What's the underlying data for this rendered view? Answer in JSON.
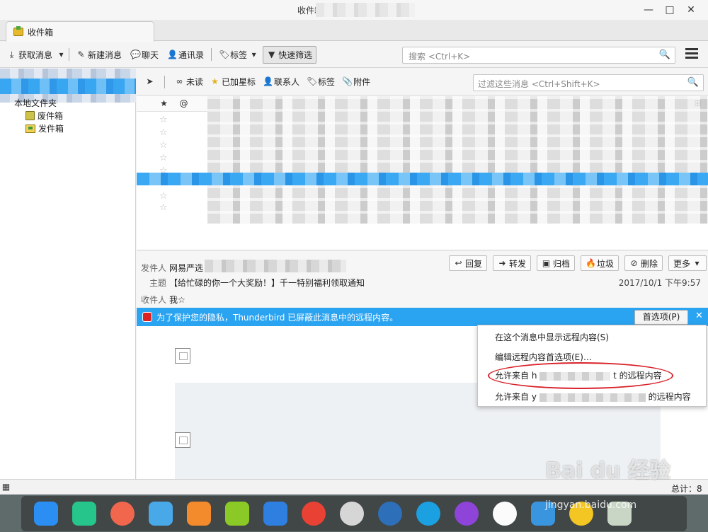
{
  "window": {
    "title_visible": "收件箱",
    "minimize": "—",
    "maximize": "□",
    "close": "✕"
  },
  "tab": {
    "label": "收件箱"
  },
  "toolbar": {
    "get_mail": "获取消息",
    "new_message": "新建消息",
    "chat": "聊天",
    "address_book": "通讯录",
    "tag": "标签",
    "quick_filter": "快速筛选",
    "search_placeholder": "搜索 <Ctrl+K>"
  },
  "folders": {
    "local_folders": "本地文件夹",
    "trash": "废件箱",
    "sent": "发件箱"
  },
  "filter_bar": {
    "unread": "未读",
    "starred": "已加星标",
    "contact": "联系人",
    "tags": "标签",
    "attachment": "附件",
    "filter_placeholder": "过滤这些消息 <Ctrl+Shift+K>"
  },
  "message": {
    "from_label": "发件人",
    "from_value": "网易严选",
    "subject_label": "主题",
    "subject_value": "【给忙碌的你一个大奖励！】千一特别福利领取通知",
    "to_label": "收件人",
    "to_value": "我☆",
    "date": "2017/10/1 下午9:57",
    "actions": {
      "reply": "回复",
      "forward": "转发",
      "archive": "归档",
      "junk": "垃圾",
      "delete": "删除",
      "more": "更多"
    }
  },
  "notice": {
    "text": "为了保护您的隐私，Thunderbird 已屏蔽此消息中的远程内容。",
    "prefs_button": "首选项(P)",
    "close": "✕"
  },
  "context_menu": {
    "item1": "在这个消息中显示远程内容(S)",
    "item2": "编辑远程内容首选项(E)…",
    "item3_prefix": "允许来自 h",
    "item3_suffix": "t 的远程内容",
    "item4_prefix": "允许来自 y",
    "item4_suffix": "的远程内容"
  },
  "status": {
    "total": "总计：8"
  },
  "watermark": {
    "brand": "Bai du 经验",
    "url": "jingyan.baidu.com"
  },
  "colors": {
    "accent": "#2aa3f1",
    "highlight_circle": "#d8222a"
  }
}
